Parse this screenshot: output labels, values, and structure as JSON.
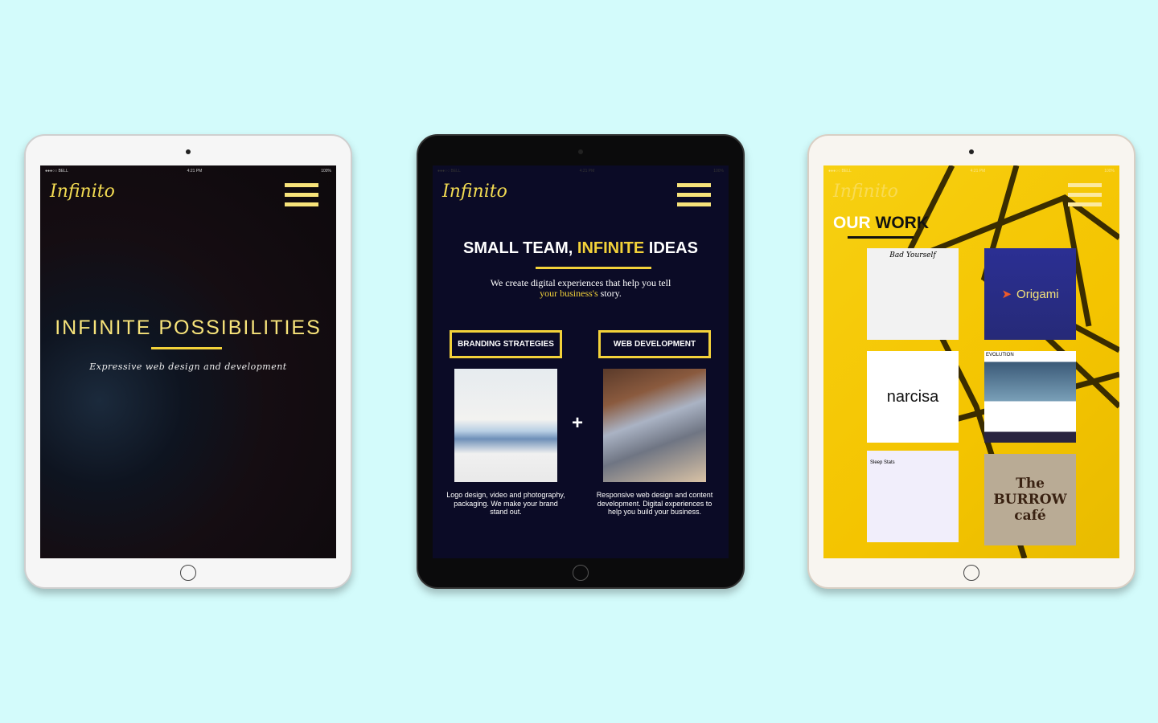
{
  "devices": [
    {
      "status": {
        "carrier": "●●●○○ BELL",
        "time": "4:21 PM",
        "battery": "100%"
      },
      "logo": "Infinito",
      "headline": "INFINITE POSSIBILITIES",
      "tagline": "Expressive web design and development"
    },
    {
      "status": {
        "carrier": "●●●○○ BELL",
        "time": "4:21 PM",
        "battery": "100%"
      },
      "logo": "Infinito",
      "headline_a": "SMALL TEAM, ",
      "headline_b": "INFINITE",
      "headline_c": " IDEAS",
      "intro_a": "We create digital experiences that help you tell",
      "intro_b": "your business's",
      "intro_c": " story.",
      "services": [
        {
          "label": "BRANDING STRATEGIES",
          "desc": "Logo design, video and photography, packaging. We make your brand stand out."
        },
        {
          "label": "WEB DEVELOPMENT",
          "desc": "Responsive web design and content development. Digital experiences to help you build your business."
        }
      ],
      "plus": "+"
    },
    {
      "status": {
        "carrier": "●●●○○ BELL",
        "time": "4:21 PM",
        "battery": "100%"
      },
      "logo": "Infinito",
      "headline_a": "OUR ",
      "headline_b": "WORK",
      "portfolio": [
        "Bad Yourself",
        "Origami",
        "narcisa",
        "EVOLUTION",
        "Sleep Stats",
        "The BURROW café"
      ]
    }
  ],
  "colors": {
    "background": "#d3fbfb",
    "accent": "#f3d23a",
    "navy": "#0b0b26",
    "origami": "#2a2f8f"
  }
}
